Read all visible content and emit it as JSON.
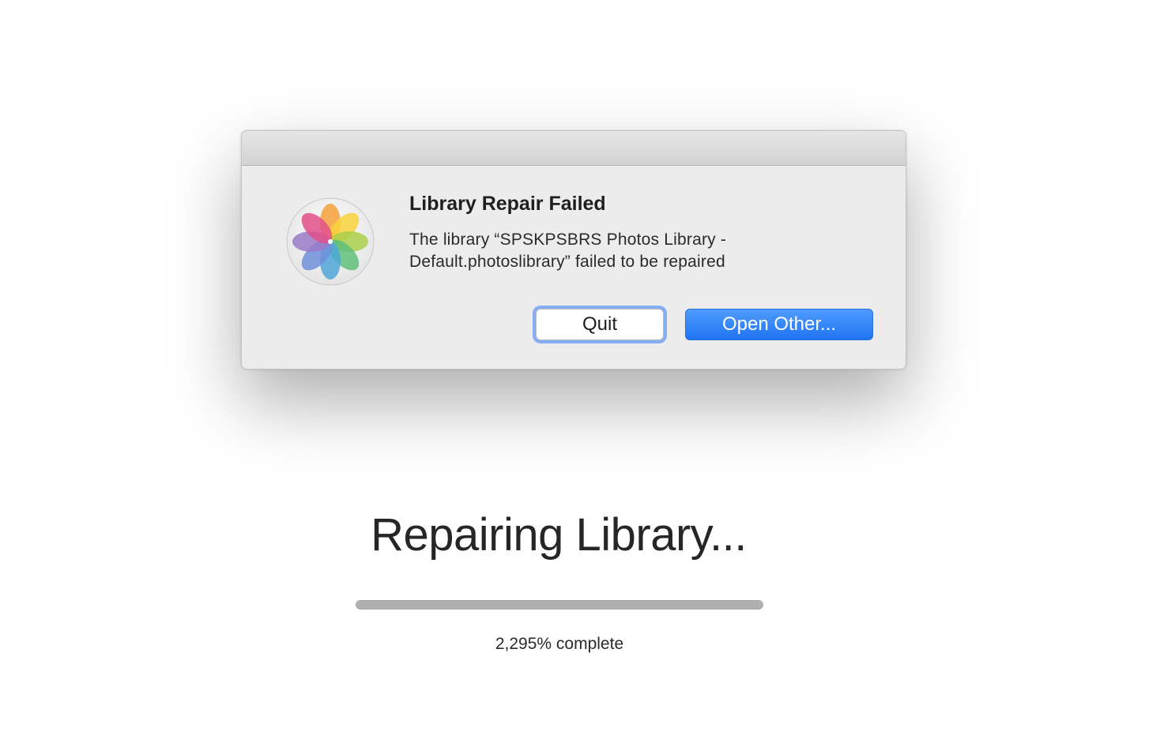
{
  "dialog": {
    "title": "Library Repair Failed",
    "message": "The library “SPSKPSBRS Photos Library - Default.photoslibrary” failed to be repaired",
    "icon": "photos-app-icon",
    "buttons": {
      "quit_label": "Quit",
      "open_other_label": "Open Other..."
    },
    "accent_color": "#1f74f2"
  },
  "background": {
    "title": "Repairing Library...",
    "progress_fraction": 1.0,
    "status_text": "2,295% complete"
  }
}
